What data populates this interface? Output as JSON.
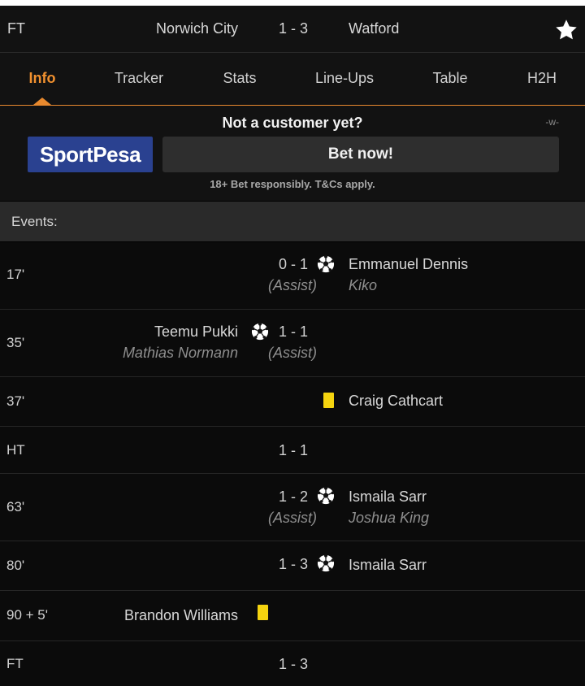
{
  "header": {
    "status": "FT",
    "home_team": "Norwich City",
    "score": "1 - 3",
    "away_team": "Watford",
    "favorite_icon": "star-icon"
  },
  "tabs": [
    {
      "label": "Info",
      "active": true
    },
    {
      "label": "Tracker",
      "active": false
    },
    {
      "label": "Stats",
      "active": false
    },
    {
      "label": "Line-Ups",
      "active": false
    },
    {
      "label": "Table",
      "active": false
    },
    {
      "label": "H2H",
      "active": false
    }
  ],
  "promo": {
    "title": "Not a customer yet?",
    "watermark": "-w-",
    "brand": "SportPesa",
    "brand_color": "#2a4190",
    "cta": "Bet now!",
    "disclaimer": "18+ Bet responsibly. T&Cs apply."
  },
  "events": {
    "heading": "Events:",
    "items": [
      {
        "minute": "17'",
        "score": "0 - 1",
        "type": "goal",
        "side": "away",
        "player": "Emmanuel Dennis",
        "assist_label": "(Assist)",
        "assist_player": "Kiko"
      },
      {
        "minute": "35'",
        "score": "1 - 1",
        "type": "goal",
        "side": "home",
        "player": "Teemu Pukki",
        "assist_label": "(Assist)",
        "assist_player": "Mathias Normann"
      },
      {
        "minute": "37'",
        "type": "yellow-card",
        "side": "away",
        "player": "Craig Cathcart"
      },
      {
        "minute": "HT",
        "score": "1 - 1",
        "type": "period"
      },
      {
        "minute": "63'",
        "score": "1 - 2",
        "type": "goal",
        "side": "away",
        "player": "Ismaila Sarr",
        "assist_label": "(Assist)",
        "assist_player": "Joshua King"
      },
      {
        "minute": "80'",
        "score": "1 - 3",
        "type": "goal",
        "side": "away",
        "player": "Ismaila Sarr"
      },
      {
        "minute": "90 + 5'",
        "type": "yellow-card",
        "side": "home",
        "player": "Brandon Williams"
      },
      {
        "minute": "FT",
        "score": "1 - 3",
        "type": "period"
      }
    ]
  },
  "colors": {
    "accent": "#e8892e",
    "yellow_card": "#f5d40f",
    "background": "#000000"
  }
}
